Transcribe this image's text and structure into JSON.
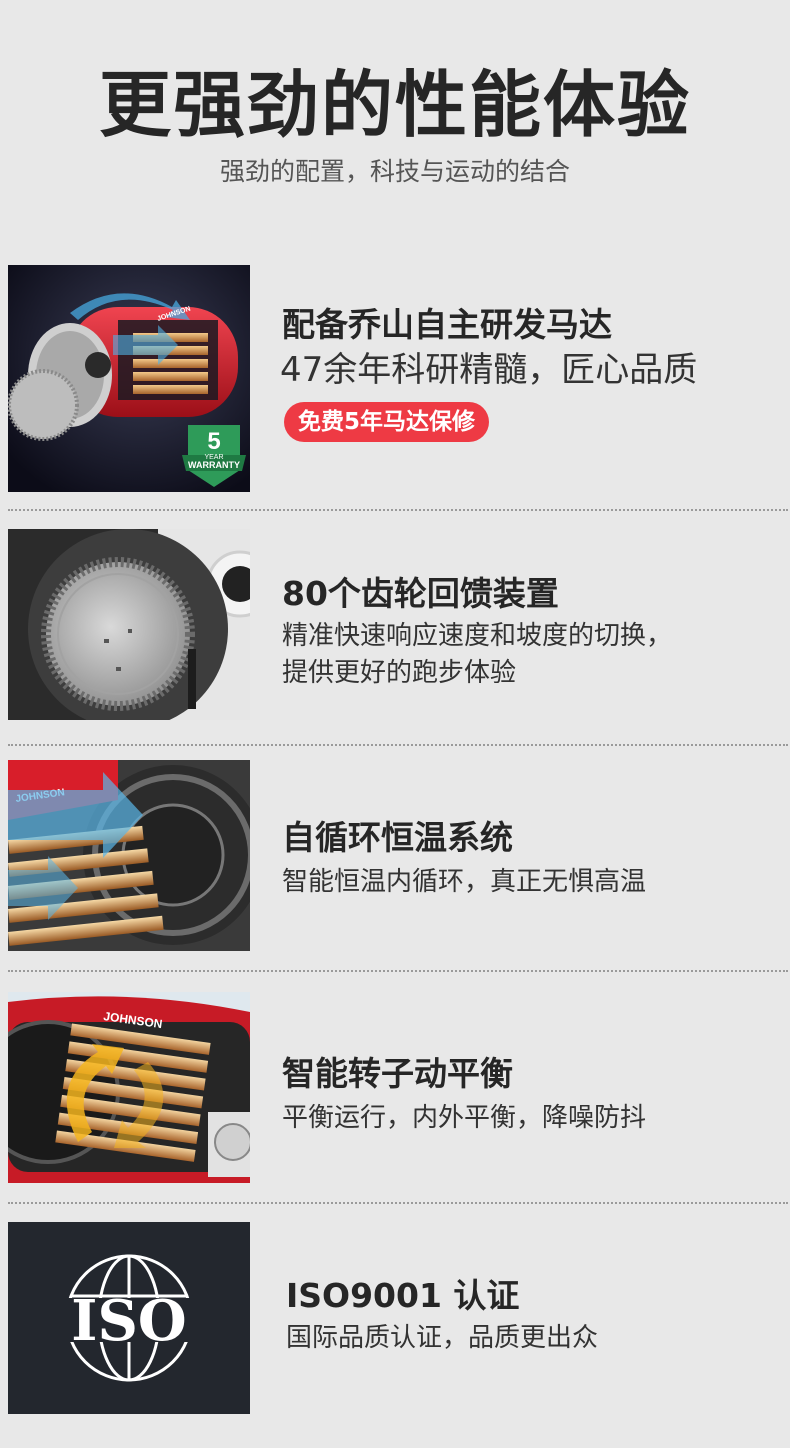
{
  "header": {
    "title": "更强劲的性能体验",
    "subtitle": "强劲的配置，科技与运动的结合"
  },
  "features": [
    {
      "title": "配备乔山自主研发马达",
      "desc": "47余年科研精髓，匠心品质",
      "badge": "免费5年马达保修",
      "image_overlay": {
        "years": "5",
        "year_label": "YEAR",
        "warranty_label": "WARRANTY",
        "brand": "JOHNSON"
      }
    },
    {
      "title": "80个齿轮回馈装置",
      "desc_lines": [
        "精准快速响应速度和坡度的切换，",
        "提供更好的跑步体验"
      ]
    },
    {
      "title": "自循环恒温系统",
      "desc": "智能恒温内循环，真正无惧高温",
      "image_overlay": {
        "brand": "JOHNSON"
      }
    },
    {
      "title": "智能转子动平衡",
      "desc": "平衡运行，内外平衡，降噪防抖",
      "image_overlay": {
        "brand": "JOHNSON"
      }
    },
    {
      "title": "ISO9001 认证",
      "desc": "国际品质认证，品质更出众",
      "image_overlay": {
        "logo_text": "ISO"
      }
    }
  ],
  "colors": {
    "background": "#e8e8e8",
    "badge": "#ee3a44",
    "motor_red": "#d81e2a",
    "dark_panel": "#23272e"
  }
}
